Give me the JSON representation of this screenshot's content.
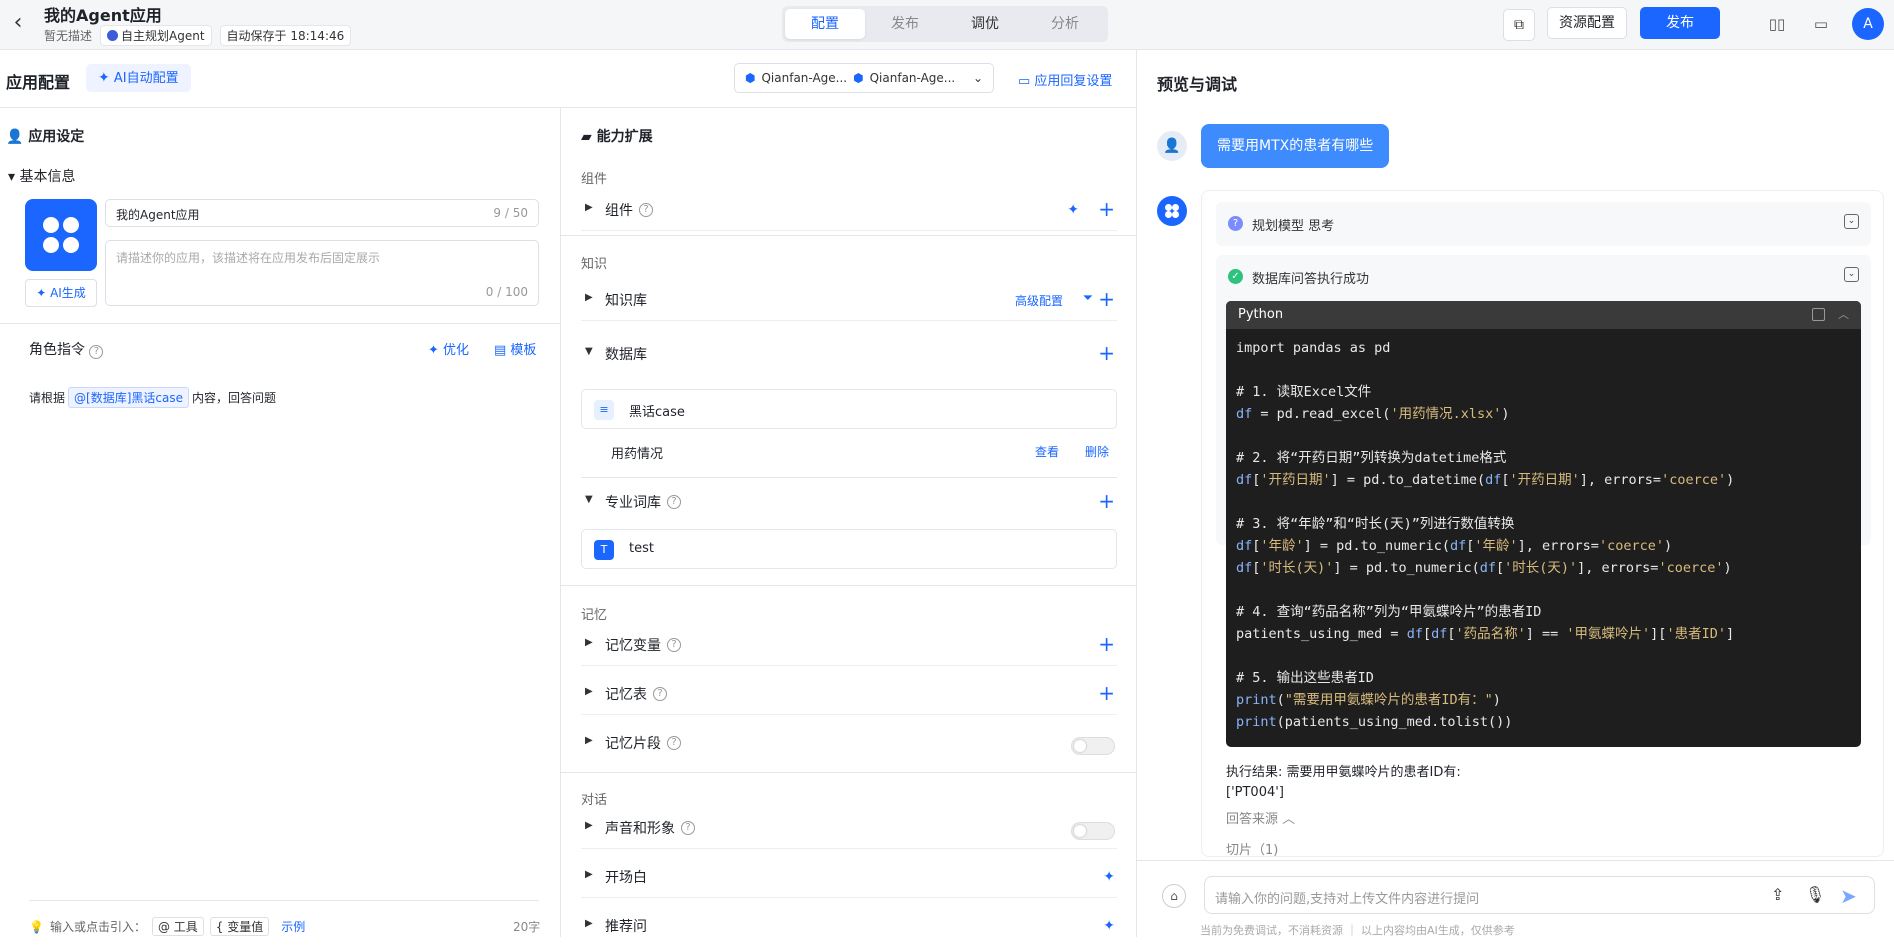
{
  "topbar": {
    "app_title": "我的Agent应用",
    "desc": "暂无描述",
    "agent_type": "自主规划Agent",
    "autosave": "自动保存于 18:14:46",
    "tabs": [
      "配置",
      "发布",
      "调优",
      "分析"
    ],
    "active_tab": "配置",
    "resource_btn": "资源配置",
    "publish_btn": "发布",
    "avatar_letter": "A"
  },
  "config": {
    "title": "应用配置",
    "ai_auto": "AI自动配置",
    "model_a": "Qianfan-Age...",
    "model_b": "Qianfan-Age...",
    "reply_settings": "应用回复设置"
  },
  "left": {
    "section": "应用设定",
    "basic_info": "基本信息",
    "name_value": "我的Agent应用",
    "name_count": "9 / 50",
    "desc_placeholder": "请描述你的应用，该描述将在应用发布后固定展示",
    "desc_count": "0 / 100",
    "ai_gen": "AI生成",
    "role_title": "角色指令",
    "optimize": "优化",
    "template": "模板",
    "role_prefix": "请根据",
    "role_mention": "@[数据库]黑话case",
    "role_suffix": "内容，回答问题",
    "footer_hint": "输入或点击引入：",
    "tool_tag": "@ 工具",
    "var_tag": "{ 变量值",
    "example": "示例",
    "char_count": "20字"
  },
  "middle": {
    "section": "能力扩展",
    "grp_component": "组件",
    "component": "组件",
    "grp_knowledge": "知识",
    "kb": "知识库",
    "kb_advanced": "高级配置",
    "database": "数据库",
    "db_card": "黑话case",
    "db_table": "用药情况",
    "view": "查看",
    "delete": "删除",
    "glossary": "专业词库",
    "glossary_card": "test",
    "grp_memory": "记忆",
    "mem_var": "记忆变量",
    "mem_table": "记忆表",
    "mem_snip": "记忆片段",
    "grp_dialog": "对话",
    "voice": "声音和形象",
    "opening": "开场白",
    "suggest": "推荐问"
  },
  "preview": {
    "title": "预览与调试",
    "user_msg": "需要用MTX的患者有哪些",
    "step1": "规划模型 思考",
    "step2": "数据库问答执行成功",
    "code_lang": "Python",
    "result_line1": "执行结果: 需要用甲氨蝶呤片的患者ID有:",
    "result_line2": "['PT004']",
    "source": "回答来源",
    "slice": "切片（1)",
    "input_placeholder": "请输入你的问题,支持对上传文件内容进行提问",
    "disclaimer": "当前为免费调试，不消耗资源  ｜  以上内容均由AI生成，仅供参考"
  },
  "colors": {
    "accent": "#1a66ff",
    "user_bubble": "#3d8bfd",
    "code_bg": "#1e1e1e"
  }
}
